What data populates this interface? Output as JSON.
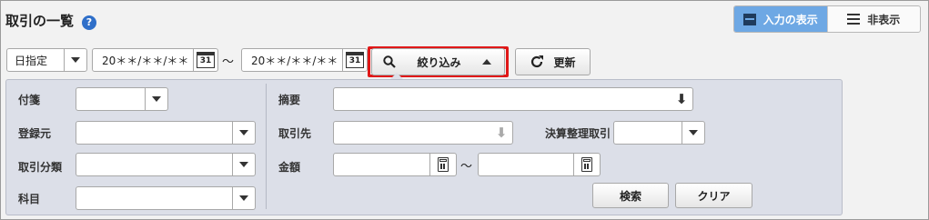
{
  "header": {
    "title": "取引の一覧",
    "help_icon": "question-circle-icon",
    "help_glyph": "?"
  },
  "view_toggle": {
    "input_label": "入力の表示",
    "hide_label": "非表示",
    "active": "入力の表示",
    "active_color": "#6ea8e4"
  },
  "toolbar": {
    "date_mode": "日指定",
    "date_from": "20＊＊/＊＊/＊＊",
    "date_to": "20＊＊/＊＊/＊＊",
    "range_sep": "〜",
    "calendar_day": "31",
    "filter_label": "絞り込み",
    "refresh_label": "更新",
    "highlight_color": "#e01818"
  },
  "filter": {
    "tag_label": "付箋",
    "source_label": "登録元",
    "category_label": "取引分類",
    "account_label": "科目",
    "summary_label": "摘要",
    "partner_label": "取引先",
    "settlement_label": "決算整理取引",
    "amount_label": "金額",
    "amount_sep": "〜",
    "search_label": "検索",
    "clear_label": "クリア"
  }
}
